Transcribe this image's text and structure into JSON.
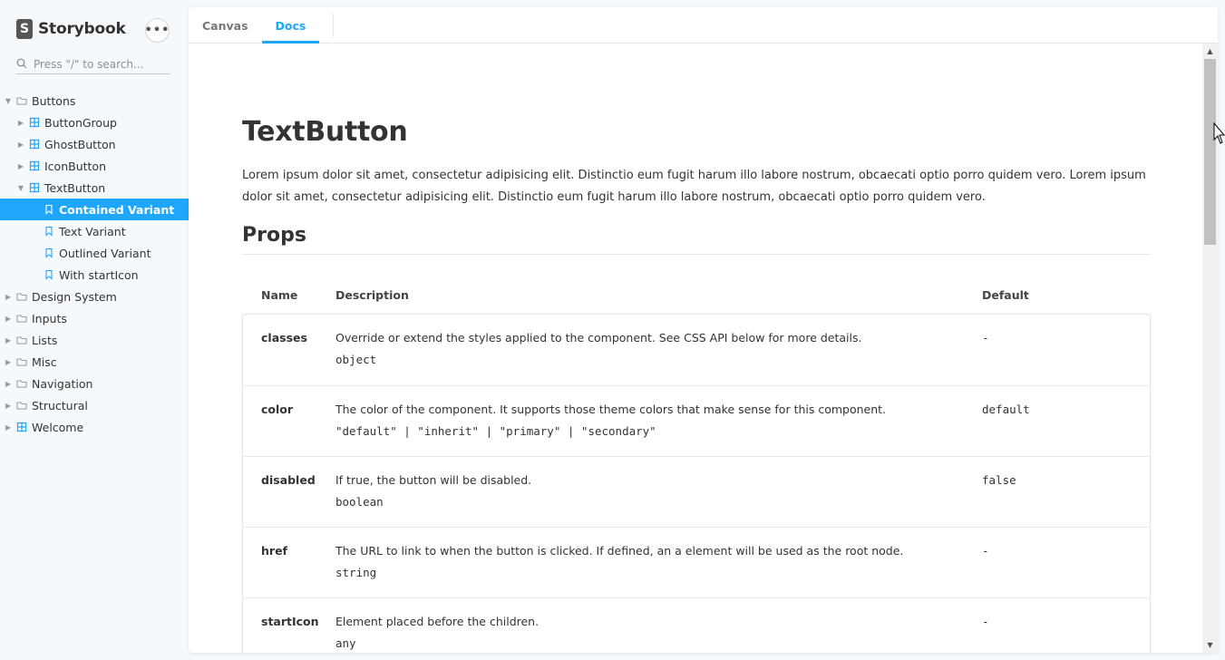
{
  "sidebar": {
    "brand": {
      "logo_letter": "S",
      "name": "Storybook"
    },
    "menu_label": "•••",
    "search": {
      "placeholder": "Press \"/\" to search...",
      "value": ""
    },
    "tree": [
      {
        "label": "Buttons",
        "level": 0,
        "type": "folder",
        "expanded": true,
        "selected": false
      },
      {
        "label": "ButtonGroup",
        "level": 1,
        "type": "component",
        "expanded": false,
        "selected": false
      },
      {
        "label": "GhostButton",
        "level": 1,
        "type": "component",
        "expanded": false,
        "selected": false
      },
      {
        "label": "IconButton",
        "level": 1,
        "type": "component",
        "expanded": false,
        "selected": false
      },
      {
        "label": "TextButton",
        "level": 1,
        "type": "component",
        "expanded": true,
        "selected": false
      },
      {
        "label": "Contained Variant",
        "level": 2,
        "type": "story",
        "selected": true
      },
      {
        "label": "Text Variant",
        "level": 2,
        "type": "story",
        "selected": false
      },
      {
        "label": "Outlined Variant",
        "level": 2,
        "type": "story",
        "selected": false
      },
      {
        "label": "With startIcon",
        "level": 2,
        "type": "story",
        "selected": false
      },
      {
        "label": "Design System",
        "level": 0,
        "type": "folder",
        "expanded": false,
        "selected": false
      },
      {
        "label": "Inputs",
        "level": 0,
        "type": "folder",
        "expanded": false,
        "selected": false
      },
      {
        "label": "Lists",
        "level": 0,
        "type": "folder",
        "expanded": false,
        "selected": false
      },
      {
        "label": "Misc",
        "level": 0,
        "type": "folder",
        "expanded": false,
        "selected": false
      },
      {
        "label": "Navigation",
        "level": 0,
        "type": "folder",
        "expanded": false,
        "selected": false
      },
      {
        "label": "Structural",
        "level": 0,
        "type": "folder",
        "expanded": false,
        "selected": false
      },
      {
        "label": "Welcome",
        "level": 0,
        "type": "component",
        "expanded": false,
        "selected": false
      }
    ]
  },
  "tabs": [
    {
      "label": "Canvas",
      "active": false
    },
    {
      "label": "Docs",
      "active": true
    }
  ],
  "doc": {
    "title": "TextButton",
    "description": "Lorem ipsum dolor sit amet, consectetur adipisicing elit. Distinctio eum fugit harum illo labore nostrum, obcaecati optio porro quidem vero. Lorem ipsum dolor sit amet, consectetur adipisicing elit. Distinctio eum fugit harum illo labore nostrum, obcaecati optio porro quidem vero.",
    "props_title": "Props",
    "columns": {
      "name": "Name",
      "description": "Description",
      "default": "Default"
    },
    "props": [
      {
        "name": "classes",
        "description": "Override or extend the styles applied to the component. See CSS API below for more details.",
        "type": "object",
        "default": "-"
      },
      {
        "name": "color",
        "description": "The color of the component. It supports those theme colors that make sense for this component.",
        "type": "\"default\" | \"inherit\" | \"primary\" | \"secondary\"",
        "default": "default"
      },
      {
        "name": "disabled",
        "description": "If true, the button will be disabled.",
        "type": "boolean",
        "default": "false"
      },
      {
        "name": "href",
        "description": "The URL to link to when the button is clicked. If defined, an a element will be used as the root node.",
        "type": "string",
        "default": "-"
      },
      {
        "name": "startIcon",
        "description": "Element placed before the children.",
        "type": "any",
        "default": "-"
      }
    ]
  },
  "colors": {
    "accent": "#1ea7fd",
    "sidebar_bg": "#f6f9fc",
    "text": "#333333"
  }
}
